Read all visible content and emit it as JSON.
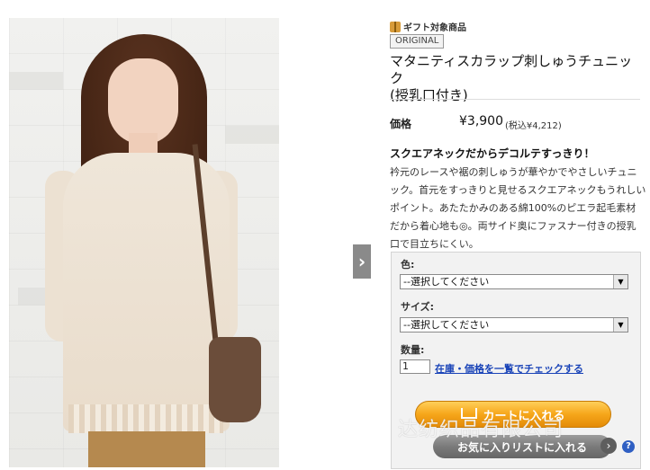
{
  "gift": {
    "label": "ギフト対象商品",
    "icon": "gift-icon"
  },
  "badge": "ORIGINAL",
  "product": {
    "title_line1": "マタニティスカラップ刺しゅうチュニック",
    "title_line2": "(授乳口付き)"
  },
  "price": {
    "label": "価格",
    "value": "¥3,900",
    "tax": "(税込¥4,212)"
  },
  "description": {
    "heading": "スクエアネックだからデコルテすっきり！",
    "lines": [
      "衿元のレースや裾の刺しゅうが華やかでやさしいチュニ",
      "ック。首元をすっきりと見せるスクエアネックもうれしい",
      "ポイント。あたたかみのある綿100%のピエラ起毛素材",
      "だから着心地も◎。両サイド奥にファスナー付きの授乳",
      "口で目立ちにくい。"
    ]
  },
  "options": {
    "color_label": "色:",
    "color_value": "--選択してください",
    "size_label": "サイズ:",
    "size_value": "--選択してください",
    "qty_label": "数量:",
    "qty_value": "1",
    "check_link": "在庫・価格を一覧でチェックする"
  },
  "buttons": {
    "cart": "カートに入れる",
    "favorite": "お気に入りリストに入れる",
    "help": "?"
  },
  "watermark": "达纺织品有限公司"
}
